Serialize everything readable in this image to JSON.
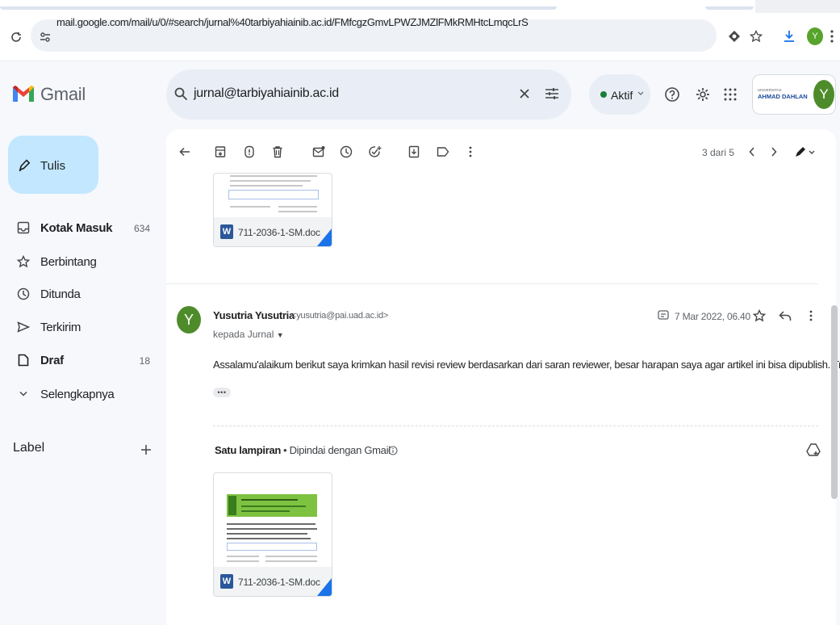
{
  "browser": {
    "url": "mail.google.com/mail/u/0/#search/jurnal%40tarbiyahiainib.ac.id/FMfcgzGmvLPWZJMZlFMkRMHtcLmqcLrS",
    "profile_initial": "Y",
    "icons": [
      "reload-icon",
      "site-settings-icon",
      "extension-icon",
      "bookmark-star-icon",
      "download-icon",
      "more-vert-icon"
    ]
  },
  "app": {
    "name": "Gmail",
    "search_query": "jurnal@tarbiyahiainib.ac.id",
    "status": "Aktif",
    "org_logo": "UNIVERSITAS AHMAD DAHLAN",
    "account_initial": "Y"
  },
  "compose": {
    "label": "Tulis"
  },
  "nav": [
    {
      "label": "Kotak Masuk",
      "count": "634",
      "icon": "inbox-icon"
    },
    {
      "label": "Berbintang",
      "count": "",
      "icon": "star-icon"
    },
    {
      "label": "Ditunda",
      "count": "",
      "icon": "clock-icon"
    },
    {
      "label": "Terkirim",
      "count": "",
      "icon": "send-icon"
    },
    {
      "label": "Draf",
      "count": "18",
      "icon": "draft-icon"
    },
    {
      "label": "Selengkapnya",
      "count": "",
      "icon": "chevron-down-icon"
    }
  ],
  "labels": {
    "title": "Label"
  },
  "toolbar": {
    "pager": "3 dari 5"
  },
  "thread": {
    "previous_attachment": {
      "filename": "711-2036-1-SM.doc"
    },
    "message": {
      "sender_initial": "Y",
      "sender_name": "Yusutria Yusutria",
      "sender_email": "<yusutria@pai.uad.ac.id>",
      "recipient": "kepada Jurnal",
      "date": "7 Mar 2022, 06.40",
      "body": "Assalamu'alaikum berikut saya krimkan hasil revisi review berdasarkan dari saran reviewer, besar harapan saya agar artikel ini bisa dipublish. Trims",
      "attachments_title": "Satu lampiran",
      "attachments_scan": "•  Dipindai dengan Gmail",
      "attachment": {
        "filename": "711-2036-1-SM.doc"
      }
    }
  },
  "colors": {
    "compose_bg": "#c2e7ff",
    "search_bg": "#e9eef6",
    "avatar_green": "#4e8c2b",
    "status_green": "#188038",
    "word_blue": "#2b579a"
  }
}
